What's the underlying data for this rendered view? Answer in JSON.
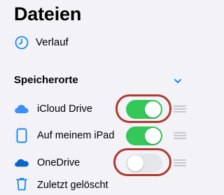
{
  "header": {
    "title": "Dateien"
  },
  "recent": {
    "label": "Verlauf",
    "icon": "clock-icon"
  },
  "locations": {
    "section_title": "Speicherorte",
    "items": [
      {
        "label": "iCloud Drive",
        "icon": "icloud-icon",
        "enabled": true,
        "highlighted": true
      },
      {
        "label": "Auf meinem iPad",
        "icon": "ipad-icon",
        "enabled": true,
        "highlighted": false
      },
      {
        "label": "OneDrive",
        "icon": "onedrive-icon",
        "enabled": false,
        "highlighted": true
      }
    ],
    "partial_item": {
      "label": "Zuletzt gelöscht",
      "icon": "trash-icon"
    }
  },
  "colors": {
    "accent": "#007aff",
    "toggle_on": "#34c759",
    "toggle_off": "#e6e6ea",
    "highlight_ring": "#b03a2e",
    "background": "#f2f2f7"
  }
}
